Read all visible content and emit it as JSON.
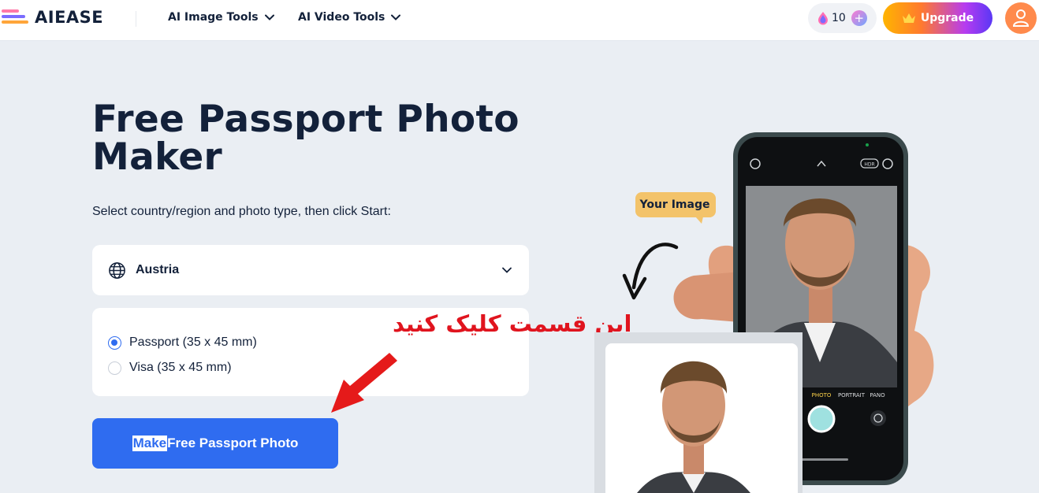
{
  "header": {
    "logo_text": "AIEASE",
    "nav": [
      {
        "label": "AI Image Tools"
      },
      {
        "label": "AI Video Tools"
      }
    ],
    "credits": "10",
    "upgrade_label": "Upgrade"
  },
  "hero": {
    "title_line1": "Free Passport Photo",
    "title_line2": "Maker",
    "subtitle": "Select country/region and photo type, then click Start:",
    "country": "Austria",
    "photo_types": [
      {
        "label": "Passport (35 x 45 mm)",
        "selected": true
      },
      {
        "label": "Visa (35 x 45 mm)",
        "selected": false
      }
    ],
    "button_highlight": "Make",
    "button_rest": "Free Passport Photo"
  },
  "annotation": {
    "text": "این قسمت کلیک کنید",
    "color": "#e0141e"
  },
  "illustration": {
    "bubble": "Your Image",
    "camera_modes": [
      "PHOTO",
      "PORTRAIT",
      "PANO"
    ],
    "hdr": "HDR"
  },
  "colors": {
    "primary": "#2f6cf0",
    "background": "#eaeef3",
    "text": "#13213a",
    "avatar": "#ff8a4c"
  }
}
